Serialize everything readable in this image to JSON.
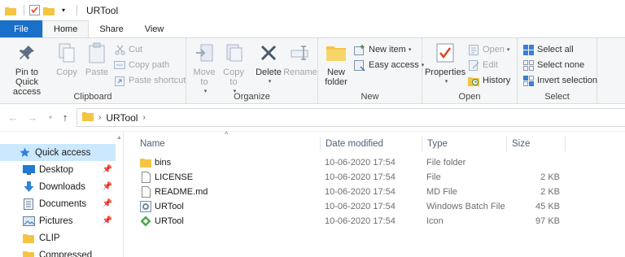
{
  "window": {
    "title": "URTool"
  },
  "tabs": {
    "file": "File",
    "home": "Home",
    "share": "Share",
    "view": "View"
  },
  "ribbon": {
    "clipboard": {
      "label": "Clipboard",
      "pin": "Pin to Quick access",
      "copy": "Copy",
      "paste": "Paste",
      "cut": "Cut",
      "copy_path": "Copy path",
      "paste_shortcut": "Paste shortcut"
    },
    "organize": {
      "label": "Organize",
      "move_to": "Move to",
      "copy_to": "Copy to",
      "delete": "Delete",
      "rename": "Rename"
    },
    "new": {
      "label": "New",
      "new_folder": "New folder",
      "new_item": "New item",
      "easy_access": "Easy access"
    },
    "open": {
      "label": "Open",
      "properties": "Properties",
      "open": "Open",
      "edit": "Edit",
      "history": "History"
    },
    "select": {
      "label": "Select",
      "select_all": "Select all",
      "select_none": "Select none",
      "invert": "Invert selection"
    }
  },
  "address": {
    "path": "URTool"
  },
  "nav": [
    {
      "label": "Quick access",
      "icon": "star-icon",
      "pinned": false
    },
    {
      "label": "Desktop",
      "icon": "desktop-icon",
      "pinned": true
    },
    {
      "label": "Downloads",
      "icon": "download-icon",
      "pinned": true
    },
    {
      "label": "Documents",
      "icon": "documents-icon",
      "pinned": true
    },
    {
      "label": "Pictures",
      "icon": "pictures-icon",
      "pinned": true
    },
    {
      "label": "CLIP",
      "icon": "folder-icon",
      "pinned": false
    },
    {
      "label": "Compressed",
      "icon": "folder-icon",
      "pinned": false
    }
  ],
  "columns": {
    "name": "Name",
    "date": "Date modified",
    "type": "Type",
    "size": "Size"
  },
  "files": [
    {
      "name": "bins",
      "date": "10-06-2020 17:54",
      "type": "File folder",
      "size": "",
      "icon": "folder-icon"
    },
    {
      "name": "LICENSE",
      "date": "10-06-2020 17:54",
      "type": "File",
      "size": "2 KB",
      "icon": "file-icon"
    },
    {
      "name": "README.md",
      "date": "10-06-2020 17:54",
      "type": "MD File",
      "size": "2 KB",
      "icon": "file-icon"
    },
    {
      "name": "URTool",
      "date": "10-06-2020 17:54",
      "type": "Windows Batch File",
      "size": "45 KB",
      "icon": "batch-file-icon"
    },
    {
      "name": "URTool",
      "date": "10-06-2020 17:54",
      "type": "Icon",
      "size": "97 KB",
      "icon": "ico-file-icon"
    }
  ],
  "colors": {
    "accent": "#1a6fc9",
    "selection": "#cce8ff",
    "folder": "#f4c542"
  }
}
